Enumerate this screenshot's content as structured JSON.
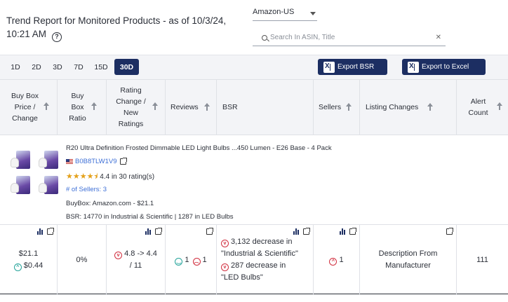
{
  "header": {
    "title": "Trend Report for Monitored Products - as of 10/3/24, 10:21 AM",
    "help_icon": "question-circle-icon",
    "marketplace": "Amazon-US",
    "search_placeholder": "Search In ASIN, Title",
    "search_clear": "✕"
  },
  "toolbar": {
    "ranges": [
      "1D",
      "2D",
      "3D",
      "7D",
      "15D",
      "30D"
    ],
    "active_range": "30D",
    "export_bsr": "Export BSR",
    "export_excel": "Export to Excel"
  },
  "columns": [
    "Buy Box Price / Change",
    "Buy Box Ratio",
    "Rating Change / New Ratings",
    "Reviews",
    "BSR",
    "Sellers",
    "Listing Changes",
    "Alert Count"
  ],
  "product": {
    "title": "R20 Ultra Definition Frosted Dimmable LED Light Bulbs ...450 Lumen - E26 Base - 4 Pack",
    "asin": "B0B8TLW1V9",
    "rating_text": "4.4 in 30 rating(s)",
    "stars": 4.4,
    "sellers": "# of Sellers: 3",
    "buybox": "BuyBox: Amazon.com - $21.1",
    "bsr": "BSR: 14770 in Industrial & Scientific | 1287 in LED Bulbs"
  },
  "row": {
    "buybox_price": "$21.1",
    "buybox_change": "$0.44",
    "buybox_ratio": "0%",
    "rating_change_a": "4.8 -> 4.4",
    "rating_change_b": "/ 11",
    "reviews_pos": "1",
    "reviews_neg": "1",
    "bsr_line1": "3,132 decrease in",
    "bsr_line2": "\"Industrial & Scientific\"",
    "bsr_line3": "287 decrease in",
    "bsr_line4": "\"LED Bulbs\"",
    "sellers": "1",
    "listing_changes": "Description From Manufacturer",
    "alert_count": "111"
  },
  "colors": {
    "navy": "#1c2e62",
    "link_blue": "#3d6fd6",
    "negative": "#d12f3f",
    "positive": "#24a39a",
    "star": "#e4a11b"
  }
}
